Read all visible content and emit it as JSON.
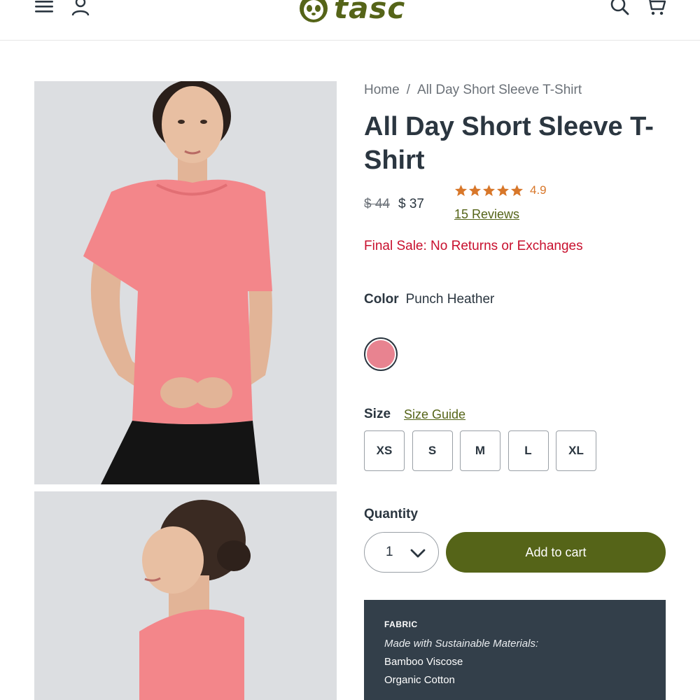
{
  "header": {
    "logo_text": "tasc"
  },
  "breadcrumb": {
    "home": "Home",
    "separator": "/",
    "current": "All Day Short Sleeve T-Shirt"
  },
  "product": {
    "title": "All Day Short Sleeve T-Shirt",
    "price_original": "$ 44",
    "price_sale": "$ 37",
    "rating_value": "4.9",
    "rating_stars": 5,
    "reviews_link": "15 Reviews",
    "final_sale_notice": "Final Sale: No Returns or Exchanges"
  },
  "color": {
    "label": "Color",
    "value": "Punch Heather"
  },
  "size": {
    "label": "Size",
    "guide_link": "Size Guide",
    "options": [
      "XS",
      "S",
      "M",
      "L",
      "XL"
    ]
  },
  "quantity": {
    "label": "Quantity",
    "value": "1"
  },
  "cart": {
    "add_label": "Add to cart"
  },
  "fabric": {
    "heading": "FABRIC",
    "note": "Made with Sustainable Materials:",
    "materials": [
      "Bamboo Viscose",
      "Organic Cotton"
    ]
  },
  "colors": {
    "brand": "#556418",
    "text": "#2b3640",
    "sale_red": "#c8102e",
    "star": "#d8772a",
    "panel": "#333f4a",
    "swatch": "#e88390"
  },
  "icons": [
    "menu-icon",
    "account-icon",
    "panda-logo-icon",
    "search-icon",
    "cart-icon",
    "star-icon",
    "chevron-down-icon"
  ]
}
